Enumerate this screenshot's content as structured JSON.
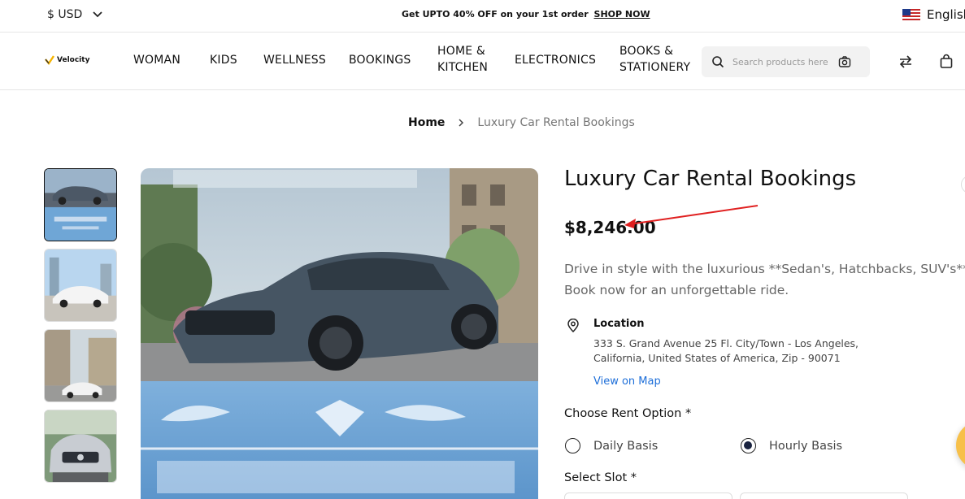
{
  "topbar": {
    "currency": "$ USD",
    "promo_text": "Get UPTO 40% OFF on your 1st order",
    "promo_link": "SHOP NOW",
    "language": "English"
  },
  "header": {
    "logo_text": "Velocity",
    "nav": [
      "WOMAN",
      "KIDS",
      "WELLNESS",
      "BOOKINGS",
      "HOME & KITCHEN",
      "ELECTRONICS",
      "BOOKS & STATIONERY"
    ],
    "search_placeholder": "Search products here"
  },
  "breadcrumb": {
    "home": "Home",
    "current": "Luxury Car Rental Bookings"
  },
  "gallery": {
    "main_image": "luxury car rental promo image",
    "thumbnails": [
      "grey sports coupe poster",
      "white sedan in city",
      "white sedan on street",
      "silver sedan front"
    ]
  },
  "product": {
    "title": "Luxury Car Rental Bookings",
    "price": "$8,246.00",
    "description_line1": "Drive in style with the luxurious **Sedan's, Hatchbacks, SUV's**",
    "description_line2": "Book now for an unforgettable ride.",
    "location_label": "Location",
    "address_line1": "333 S. Grand Avenue 25 Fl. City/Town - Los Angeles,",
    "address_line2": "California, United States of America, Zip - 90071",
    "map_link": "View on Map",
    "rent_option_label": "Choose Rent Option *",
    "rent_options": [
      {
        "label": "Daily Basis",
        "selected": false
      },
      {
        "label": "Hourly Basis",
        "selected": true
      }
    ],
    "slot_label": "Select Slot *"
  },
  "colors": {
    "accent_link": "#1e6fd9",
    "annotation_arrow": "#e02020",
    "radio_selected": "#1a2340"
  }
}
